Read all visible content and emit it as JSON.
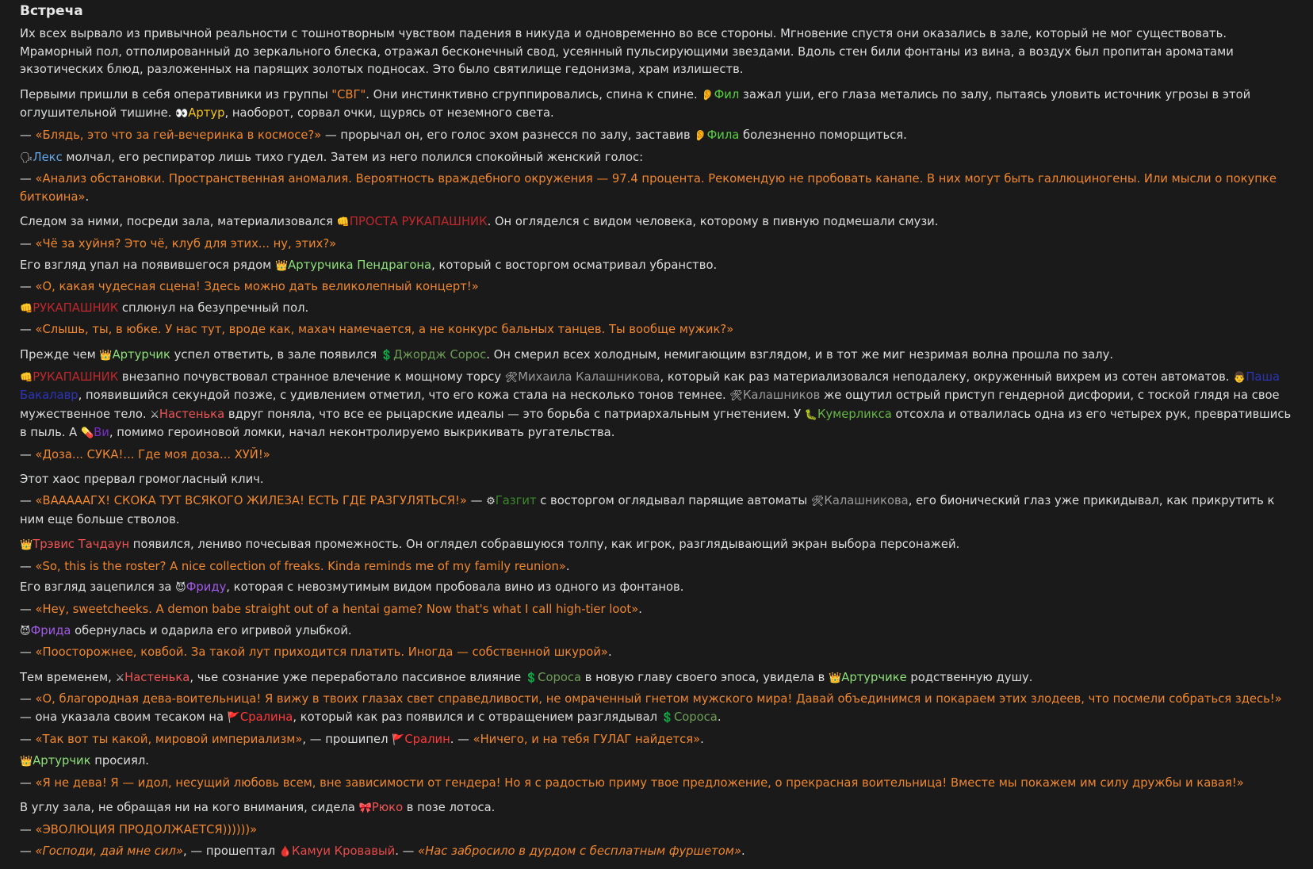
{
  "title": "Встреча",
  "paragraphs": [
    {
      "gap": false,
      "segments": [
        {
          "t": "Их всех вырвало из привычной реальности с тошнотворным чувством падения в никуда и одновременно во все стороны. Мгновение спустя они оказались в зале, который не мог существовать. Мраморный пол, отполированный до зеркального блеска, отражал бесконечный свод, усеянный пульсирующими звездами. Вдоль стен били фонтаны из вина, а воздух был пропитан ароматами экзотических блюд, разложенных на парящих золотых подносах. Это было святилище гедонизма, храм излишеств."
        }
      ]
    },
    {
      "gap": true,
      "segments": [
        {
          "t": "Первыми пришли в себя оперативники из группы "
        },
        {
          "t": "\"СВГ\"",
          "c": "#f0872d"
        },
        {
          "t": ". Они инстинктивно сгруппировались, спина к спине. "
        },
        {
          "e": "👂"
        },
        {
          "t": "Фил",
          "c": "#57d13f"
        },
        {
          "t": " зажал уши, его глаза метались по залу, пытаясь уловить источник угрозы в этой оглушительной тишине. "
        },
        {
          "e": "👀"
        },
        {
          "t": "Артур",
          "c": "#f5c518"
        },
        {
          "t": ", наоборот, сорвал очки, щурясь от неземного света."
        }
      ]
    },
    {
      "gap": false,
      "segments": [
        {
          "t": "— "
        },
        {
          "t": "«Блядь, это что за гей-вечеринка в космосе?»",
          "k": "q"
        },
        {
          "t": " — прорычал он, его голос эхом разнесся по залу, заставив "
        },
        {
          "e": "👂"
        },
        {
          "t": "Фила",
          "c": "#57d13f"
        },
        {
          "t": " болезненно поморщиться."
        }
      ]
    },
    {
      "gap": false,
      "segments": [
        {
          "e": "🗣"
        },
        {
          "t": "Лекс",
          "c": "#64a7e8"
        },
        {
          "t": " молчал, его респиратор лишь тихо гудел. Затем из него полился спокойный женский голос:"
        }
      ]
    },
    {
      "gap": false,
      "segments": [
        {
          "t": "— "
        },
        {
          "t": "«Анализ обстановки. Пространственная аномалия. Вероятность враждебного окружения — 97.4 процента. Рекомендую не пробовать канапе. В них могут быть галлюциногены. Или мысли о покупке биткоина»",
          "k": "q"
        },
        {
          "t": "."
        }
      ]
    },
    {
      "gap": true,
      "segments": [
        {
          "t": "Следом за ними, посреди зала, материализовался "
        },
        {
          "e": "👊"
        },
        {
          "t": "ПРОСТА РУКАПАШНИК",
          "c": "#c0282d"
        },
        {
          "t": ". Он огляделся с видом человека, которому в пивную подмешали смузи."
        }
      ]
    },
    {
      "gap": false,
      "segments": [
        {
          "t": "— "
        },
        {
          "t": "«Чё за хуйня? Это чё, клуб для этих... ну, этих?»",
          "k": "q"
        }
      ]
    },
    {
      "gap": false,
      "segments": [
        {
          "t": "Его взгляд упал на появившегося рядом "
        },
        {
          "e": "👑"
        },
        {
          "t": "Артурчика Пендрагона",
          "c": "#8fe07a"
        },
        {
          "t": ", который с восторгом осматривал убранство."
        }
      ]
    },
    {
      "gap": false,
      "segments": [
        {
          "t": "— "
        },
        {
          "t": "«О, какая чудесная сцена! Здесь можно дать великолепный концерт!»",
          "k": "q"
        }
      ]
    },
    {
      "gap": false,
      "segments": [
        {
          "e": "👊"
        },
        {
          "t": "РУКАПАШНИК",
          "c": "#c0282d"
        },
        {
          "t": " сплюнул на безупречный пол."
        }
      ]
    },
    {
      "gap": false,
      "segments": [
        {
          "t": "— "
        },
        {
          "t": "«Слышь, ты, в юбке. У нас тут, вроде как, махач намечается, а не конкурс бальных танцев. Ты вообще мужик?»",
          "k": "q"
        }
      ]
    },
    {
      "gap": true,
      "segments": [
        {
          "t": "Прежде чем "
        },
        {
          "e": "👑"
        },
        {
          "t": "Артурчик",
          "c": "#8fe07a"
        },
        {
          "t": " успел ответить, в зале появился "
        },
        {
          "e": "💲"
        },
        {
          "t": "Джордж Сорос",
          "c": "#6f9e58"
        },
        {
          "t": ". Он смерил всех холодным, немигающим взглядом, и в тот же миг незримая волна прошла по залу."
        }
      ]
    },
    {
      "gap": false,
      "segments": [
        {
          "e": "👊"
        },
        {
          "t": "РУКАПАШНИК",
          "c": "#c0282d"
        },
        {
          "t": " внезапно почувствовал странное влечение к мощному торсу "
        },
        {
          "e": "🛠"
        },
        {
          "t": "Михаила Калашникова",
          "c": "#9a9a9a"
        },
        {
          "t": ", который как раз материализовался неподалеку, окруженный вихрем из сотен автоматов. "
        },
        {
          "e": "👨"
        },
        {
          "t": "Паша Бакалавр",
          "c": "#2c35b8"
        },
        {
          "t": ", появившийся секундой позже, с удивлением отметил, что его кожа стала на несколько тонов темнее. "
        },
        {
          "e": "🛠"
        },
        {
          "t": "Калашников",
          "c": "#9a9a9a"
        },
        {
          "t": " же ощутил острый приступ гендерной дисфории, с тоской глядя на свое мужественное тело. "
        },
        {
          "e": "⚔"
        },
        {
          "t": "Настенька",
          "c": "#ef5555"
        },
        {
          "t": " вдруг поняла, что все ее рыцарские идеалы — это борьба с патриархальным угнетением. У "
        },
        {
          "e": "🐛"
        },
        {
          "t": "Кумерликса",
          "c": "#66b845"
        },
        {
          "t": " отсохла и отвалилась одна из его четырех рук, превратившись в пыль. А "
        },
        {
          "e": "💊"
        },
        {
          "t": "Ви",
          "c": "#7a2cc8"
        },
        {
          "t": ", помимо героиновой ломки, начал неконтролируемо выкрикивать ругательства."
        }
      ]
    },
    {
      "gap": false,
      "segments": [
        {
          "t": "— "
        },
        {
          "t": "«Доза... СУКА!... Где моя доза... ХУЙ!»",
          "k": "q"
        }
      ]
    },
    {
      "gap": true,
      "segments": [
        {
          "t": "Этот хаос прервал громогласный клич."
        }
      ]
    },
    {
      "gap": false,
      "segments": [
        {
          "t": "— "
        },
        {
          "t": "«ВАААААГХ! СКОКА ТУТ ВСЯКОГО ЖИЛЕЗА! ЕСТЬ ГДЕ РАЗГУЛЯТЬСЯ!»",
          "k": "q"
        },
        {
          "t": " — "
        },
        {
          "e": "⚙"
        },
        {
          "t": "Газгит",
          "c": "#3a8a2a"
        },
        {
          "t": " с восторгом оглядывал парящие автоматы "
        },
        {
          "e": "🛠"
        },
        {
          "t": "Калашникова",
          "c": "#9a9a9a"
        },
        {
          "t": ", его бионический глаз уже прикидывал, как прикрутить к ним еще больше стволов."
        }
      ]
    },
    {
      "gap": true,
      "segments": [
        {
          "e": "👑"
        },
        {
          "t": "Трэвис Тачдаун",
          "c": "#ef5555"
        },
        {
          "t": " появился, лениво почесывая промежность. Он оглядел собравшуюся толпу, как игрок, разглядывающий экран выбора персонажей."
        }
      ]
    },
    {
      "gap": false,
      "segments": [
        {
          "t": "— "
        },
        {
          "t": "«So, this is the roster? A nice collection of freaks. Kinda reminds me of my family reunion»",
          "k": "q"
        },
        {
          "t": "."
        }
      ]
    },
    {
      "gap": false,
      "segments": [
        {
          "t": "Его взгляд зацепился за "
        },
        {
          "e": "😈"
        },
        {
          "t": "Фриду",
          "c": "#a25ae8"
        },
        {
          "t": ", которая с невозмутимым видом пробовала вино из одного из фонтанов."
        }
      ]
    },
    {
      "gap": false,
      "segments": [
        {
          "t": "— "
        },
        {
          "t": "«Hey, sweetcheeks. A demon babe straight out of a hentai game? Now that's what I call high-tier loot»",
          "k": "q"
        },
        {
          "t": "."
        }
      ]
    },
    {
      "gap": false,
      "segments": [
        {
          "e": "😈"
        },
        {
          "t": "Фрида",
          "c": "#a25ae8"
        },
        {
          "t": " обернулась и одарила его игривой улыбкой."
        }
      ]
    },
    {
      "gap": false,
      "segments": [
        {
          "t": "— "
        },
        {
          "t": "«Поосторожнее, ковбой. За такой лут приходится платить. Иногда — собственной шкурой»",
          "k": "q"
        },
        {
          "t": "."
        }
      ]
    },
    {
      "gap": true,
      "segments": [
        {
          "t": "Тем временем, "
        },
        {
          "e": "⚔"
        },
        {
          "t": "Настенька",
          "c": "#ef5555"
        },
        {
          "t": ", чье сознание уже переработало пассивное влияние "
        },
        {
          "e": "💲"
        },
        {
          "t": "Сороса",
          "c": "#6f9e58"
        },
        {
          "t": " в новую главу своего эпоса, увидела в "
        },
        {
          "e": "👑"
        },
        {
          "t": "Артурчике",
          "c": "#8fe07a"
        },
        {
          "t": " родственную душу."
        }
      ]
    },
    {
      "gap": false,
      "segments": [
        {
          "t": "— "
        },
        {
          "t": "«О, благородная дева-воительница! Я вижу в твоих глазах свет справедливости, не омраченный гнетом мужского мира! Давай объединимся и покараем этих злодеев, что посмели собраться здесь!»",
          "k": "q"
        },
        {
          "t": " — она указала своим тесаком на "
        },
        {
          "e": "🚩"
        },
        {
          "t": "Сралина",
          "c": "#ff3a3a"
        },
        {
          "t": ", который как раз появился и с отвращением разглядывал "
        },
        {
          "e": "💲"
        },
        {
          "t": "Сороса",
          "c": "#6f9e58"
        },
        {
          "t": "."
        }
      ]
    },
    {
      "gap": false,
      "segments": [
        {
          "t": "— "
        },
        {
          "t": "«Так вот ты какой, мировой империализм»",
          "k": "q"
        },
        {
          "t": ", — прошипел "
        },
        {
          "e": "🚩"
        },
        {
          "t": "Сралин",
          "c": "#ff3a3a"
        },
        {
          "t": ". — "
        },
        {
          "t": "«Ничего, и на тебя ГУЛАГ найдется»",
          "k": "q"
        },
        {
          "t": "."
        }
      ]
    },
    {
      "gap": false,
      "segments": [
        {
          "e": "👑"
        },
        {
          "t": "Артурчик",
          "c": "#8fe07a"
        },
        {
          "t": " просиял."
        }
      ]
    },
    {
      "gap": false,
      "segments": [
        {
          "t": "— "
        },
        {
          "t": "«Я не дева! Я — идол, несущий любовь всем, вне зависимости от гендера! Но я с радостью приму твое предложение, о прекрасная воительница! Вместе мы покажем им силу дружбы и кавая!»",
          "k": "q"
        }
      ]
    },
    {
      "gap": true,
      "segments": [
        {
          "t": "В углу зала, не обращая ни на кого внимания, сидела "
        },
        {
          "e": "🎀"
        },
        {
          "t": "Рюко",
          "c": "#ef5555"
        },
        {
          "t": " в позе лотоса."
        }
      ]
    },
    {
      "gap": false,
      "segments": [
        {
          "t": "— "
        },
        {
          "t": "«ЭВОЛЮЦИЯ ПРОДОЛЖАЕТСЯ))))))»",
          "k": "q"
        }
      ]
    },
    {
      "gap": false,
      "segments": [
        {
          "t": "— "
        },
        {
          "t": "«Господи, дай мне сил»",
          "k": "qi"
        },
        {
          "t": ", — прошептал "
        },
        {
          "e": "🩸"
        },
        {
          "t": "Камуи Кровавый",
          "c": "#e84a4a"
        },
        {
          "t": ". — "
        },
        {
          "t": "«Нас забросило в дурдом с бесплатным фуршетом»",
          "k": "qi"
        },
        {
          "t": "."
        }
      ]
    }
  ]
}
